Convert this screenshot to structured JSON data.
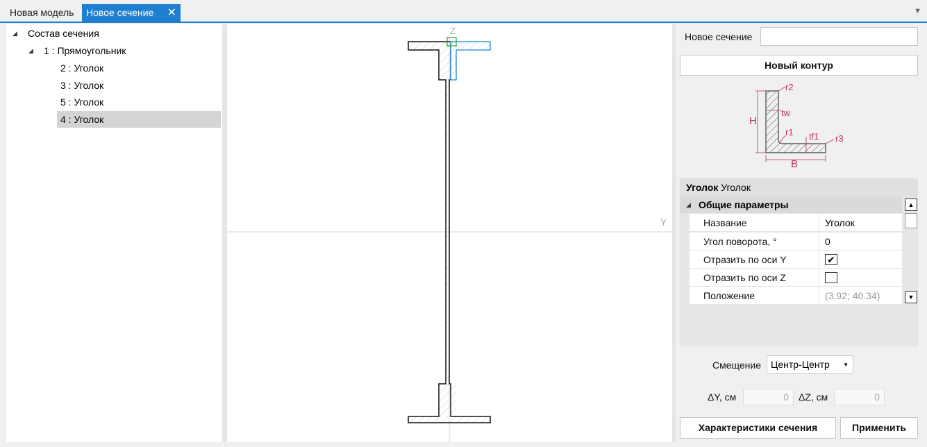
{
  "tabs": [
    {
      "label": "Новая модель",
      "active": false
    },
    {
      "label": "Новое сечение",
      "active": true
    }
  ],
  "tree": {
    "root": "Состав сечения",
    "child": "1 : Прямоугольник",
    "items": [
      "2 : Уголок",
      "3 : Уголок",
      "5 : Уголок",
      "4 : Уголок"
    ],
    "selected_index": 3
  },
  "canvas": {
    "axis_z": "Z",
    "axis_y": "Y"
  },
  "right": {
    "section_name_label": "Новое сечение",
    "section_name_value": "",
    "new_contour_button": "Новый контур",
    "diagram_labels": {
      "r2": "r2",
      "tw": "tw",
      "H": "H",
      "r1": "r1",
      "tf1": "tf1",
      "r3": "r3",
      "B": "B"
    },
    "propgrid": {
      "header_bold": "Уголок",
      "header_type": "Уголок",
      "category": "Общие параметры",
      "rows": [
        {
          "name": "Название",
          "value": "Уголок"
        },
        {
          "name": "Угол поворота, °",
          "value": "0"
        },
        {
          "name": "Отразить по оси Y",
          "checked": true
        },
        {
          "name": "Отразить по оси Z",
          "checked": false
        },
        {
          "name": "Положение",
          "value": "(3.92; 40.34)"
        }
      ]
    },
    "offset_label": "Смещение",
    "offset_value": "Центр-Центр",
    "dy_label": "ΔY, см",
    "dy_value": "0",
    "dz_label": "ΔZ, см",
    "dz_value": "0",
    "props_button": "Характеристики сечения",
    "apply_button": "Применить"
  },
  "colors": {
    "accent": "#1e7fd0",
    "selection_green": "#2ca02c",
    "selected_contour": "#3a9ad9",
    "drawing_magenta": "#c0306a"
  }
}
